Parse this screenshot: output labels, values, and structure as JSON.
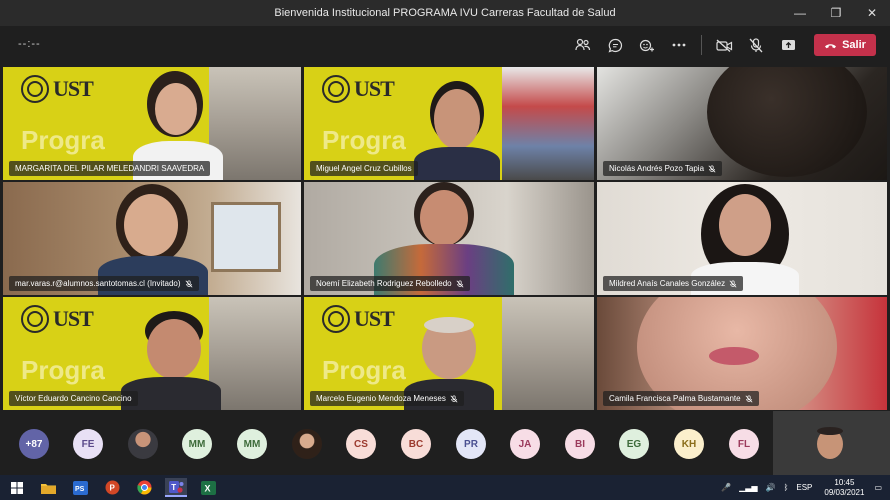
{
  "window": {
    "title": "Bienvenida Institucional PROGRAMA IVU Carreras Facultad de Salud",
    "minimize": "—",
    "maximize": "❐",
    "close": "✕"
  },
  "toolbar": {
    "timer": "--:--",
    "leave_label": "Salir",
    "icons": [
      "people-icon",
      "chat-icon",
      "reactions-icon",
      "more-icon",
      "camera-off-icon",
      "mic-off-icon",
      "share-icon",
      "phone-icon"
    ]
  },
  "brand": {
    "logo_text": "UST",
    "program_text": "Progra"
  },
  "tiles": [
    {
      "name": "MARGARITA DEL PILAR MELEDANDRI SAAVEDRA",
      "muted": false
    },
    {
      "name": "Miguel Angel Cruz Cubillos",
      "muted": false
    },
    {
      "name": "Nicolás Andrés Pozo Tapia",
      "muted": true
    },
    {
      "name": "mar.varas.r@alumnos.santotomas.cl (Invitado)",
      "muted": true
    },
    {
      "name": "Noemí Elizabeth Rodriguez Rebolledo",
      "muted": true
    },
    {
      "name": "Mildred Anaís Canales González",
      "muted": true
    },
    {
      "name": "Víctor Eduardo Cancino Cancino",
      "muted": false
    },
    {
      "name": "Marcelo Eugenio Mendoza Meneses",
      "muted": true
    },
    {
      "name": "Camila Francisca Palma Bustamante",
      "muted": true
    }
  ],
  "participants": {
    "more_count": "+87",
    "avatars": [
      {
        "initials": "FE",
        "bg": "#e8e0f5",
        "fg": "#5b4a8b"
      },
      {
        "initials": "",
        "bg": "#5d5d5d",
        "fg": "#fff",
        "photo": true
      },
      {
        "initials": "MM",
        "bg": "#dff0de",
        "fg": "#3d6b3a"
      },
      {
        "initials": "MM",
        "bg": "#dff0de",
        "fg": "#3d6b3a"
      },
      {
        "initials": "",
        "bg": "#8a7a6a",
        "fg": "#fff",
        "photo": true
      },
      {
        "initials": "CS",
        "bg": "#f8ddd8",
        "fg": "#9b3a2e"
      },
      {
        "initials": "BC",
        "bg": "#f8ddd8",
        "fg": "#9b3a2e"
      },
      {
        "initials": "PR",
        "bg": "#e3e6f7",
        "fg": "#4a5091"
      },
      {
        "initials": "JA",
        "bg": "#f7dde6",
        "fg": "#9b3a5c"
      },
      {
        "initials": "BI",
        "bg": "#f7dde6",
        "fg": "#9b3a5c"
      },
      {
        "initials": "EG",
        "bg": "#dff0de",
        "fg": "#3d6b3a"
      },
      {
        "initials": "KH",
        "bg": "#fbefcc",
        "fg": "#8a6d1a"
      },
      {
        "initials": "FL",
        "bg": "#f7dde6",
        "fg": "#9b3a5c"
      }
    ]
  },
  "taskbar": {
    "apps": [
      "windows-start-icon",
      "file-explorer-icon",
      "powerpoint-icon",
      "acrobat-icon",
      "chrome-icon",
      "teams-icon",
      "excel-icon"
    ],
    "language": "ESP",
    "time": "10:45",
    "date": "09/03/2021"
  },
  "colors": {
    "accent_leave": "#c4314b",
    "brand_yellow": "#d8d116",
    "more_badge": "#6264a7"
  }
}
